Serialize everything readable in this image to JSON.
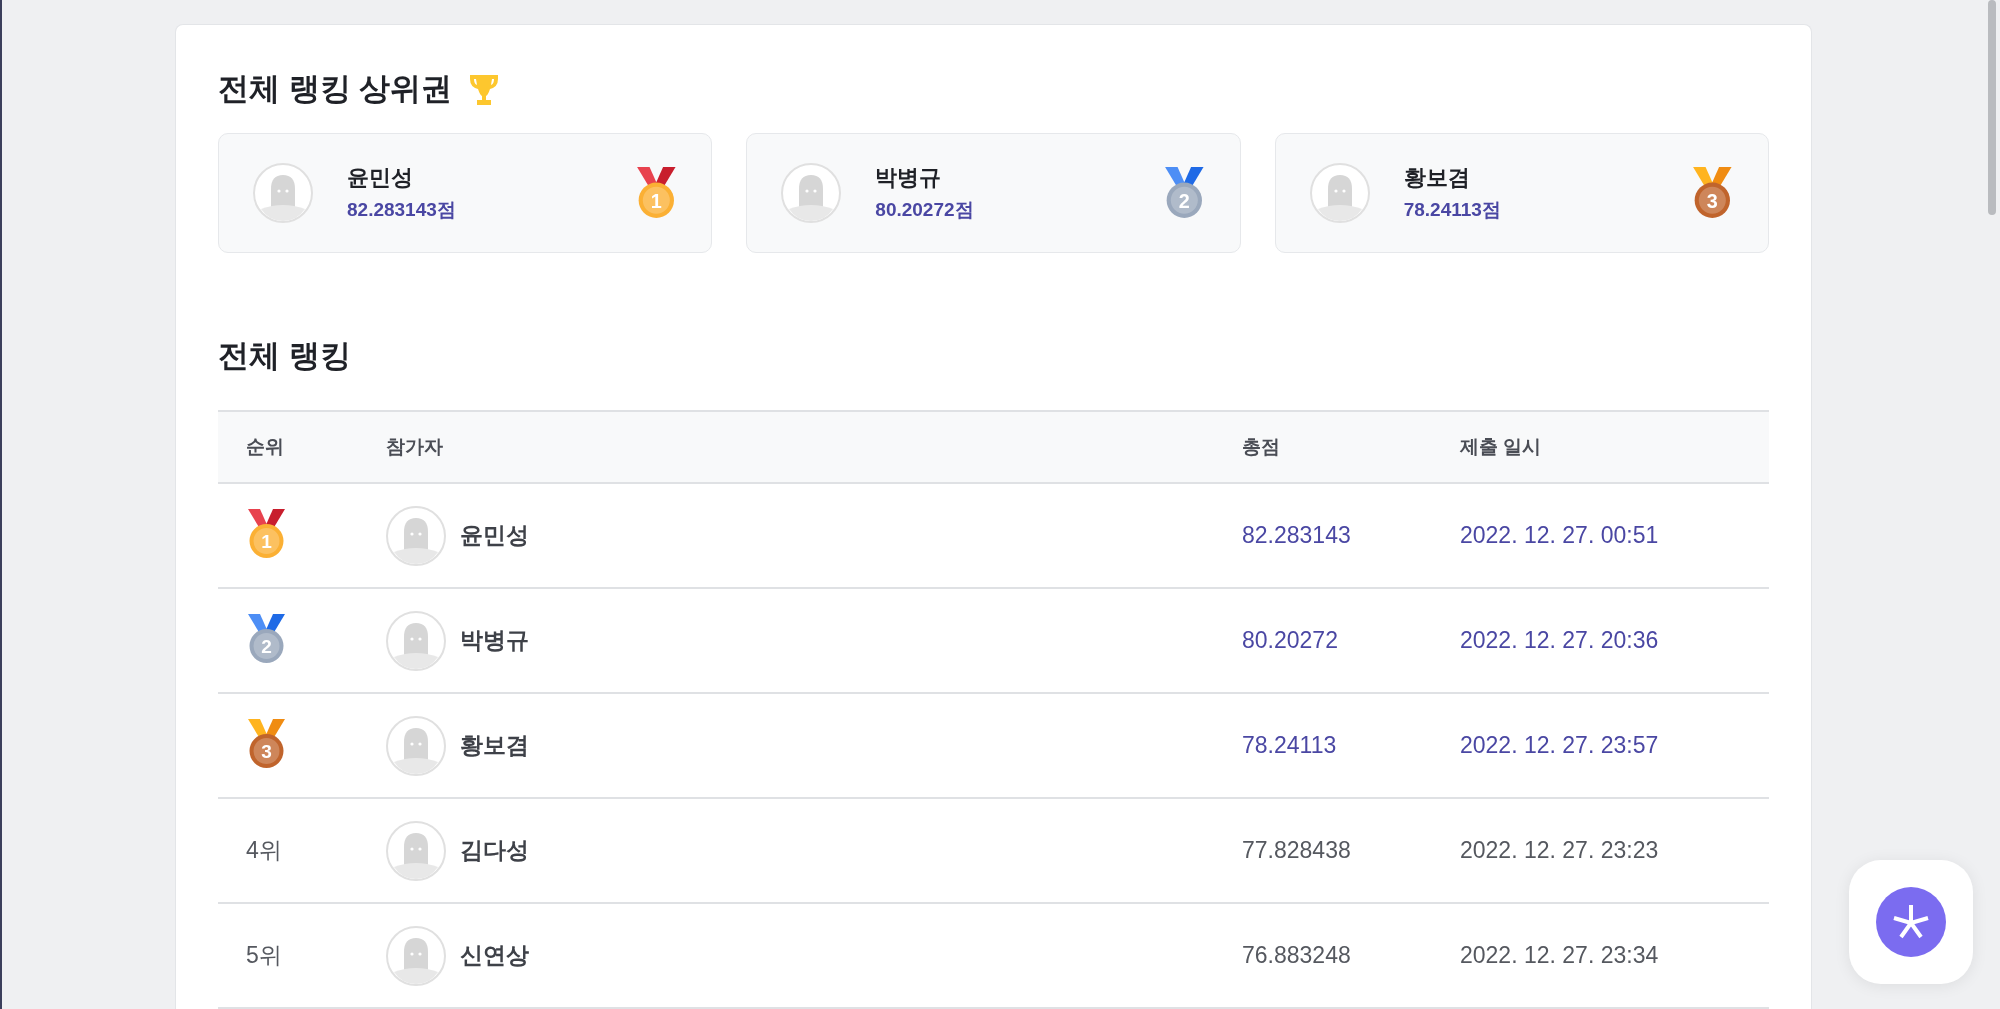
{
  "top_section": {
    "title": "전체 랭킹 상위권",
    "cards": [
      {
        "name": "윤민성",
        "score": "82.283143점",
        "medal": {
          "label": "1",
          "color": "#fbb034"
        }
      },
      {
        "name": "박병규",
        "score": "80.20272점",
        "medal": {
          "label": "2",
          "color": "#9aa8bc"
        }
      },
      {
        "name": "황보겸",
        "score": "78.24113점",
        "medal": {
          "label": "3",
          "color": "#c0642c"
        }
      }
    ]
  },
  "ranking": {
    "title": "전체 랭킹",
    "columns": [
      "순위",
      "참가자",
      "총점",
      "제출 일시"
    ],
    "rows": [
      {
        "rank": {
          "kind": "medal",
          "label": "1",
          "color": "#fbb034"
        },
        "name": "윤민성",
        "score": "82.283143",
        "submitted": "2022. 12. 27. 00:51",
        "highlighted": true
      },
      {
        "rank": {
          "kind": "medal",
          "label": "2",
          "color": "#9aa8bc"
        },
        "name": "박병규",
        "score": "80.20272",
        "submitted": "2022. 12. 27. 20:36",
        "highlighted": true
      },
      {
        "rank": {
          "kind": "medal",
          "label": "3",
          "color": "#c0642c"
        },
        "name": "황보겸",
        "score": "78.24113",
        "submitted": "2022. 12. 27. 23:57",
        "highlighted": true
      },
      {
        "rank": {
          "kind": "text",
          "label": "4위"
        },
        "name": "김다성",
        "score": "77.828438",
        "submitted": "2022. 12. 27. 23:23",
        "highlighted": false
      },
      {
        "rank": {
          "kind": "text",
          "label": "5위"
        },
        "name": "신연상",
        "score": "76.883248",
        "submitted": "2022. 12. 27. 23:34",
        "highlighted": false
      }
    ]
  }
}
